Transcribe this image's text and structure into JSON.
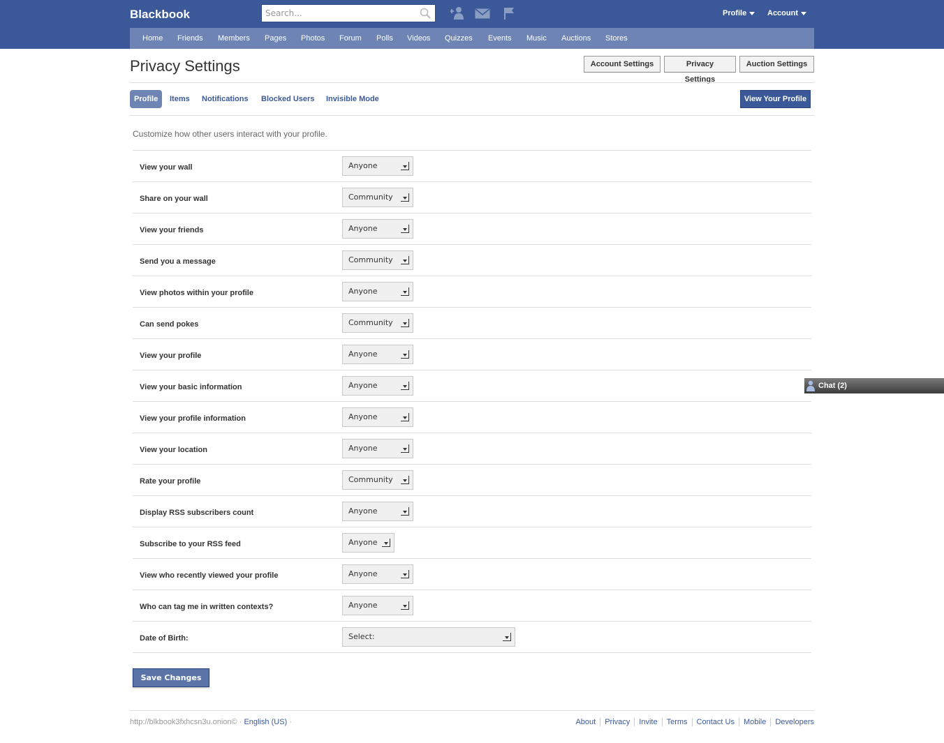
{
  "app": {
    "brand": "Blackbook",
    "search_placeholder": "Search...",
    "top_links": {
      "profile": "Profile",
      "account": "Account"
    }
  },
  "nav": [
    "Home",
    "Friends",
    "Members",
    "Pages",
    "Photos",
    "Forum",
    "Polls",
    "Videos",
    "Quizzes",
    "Events",
    "Music",
    "Auctions",
    "Stores"
  ],
  "page": {
    "title": "Privacy Settings",
    "header_buttons": [
      "Account Settings",
      "Privacy Settings",
      "Auction Settings"
    ],
    "tabs": [
      "Profile",
      "Items",
      "Notifications",
      "Blocked Users",
      "Invisible Mode"
    ],
    "active_tab": "Profile",
    "view_profile_label": "View Your Profile",
    "intro": "Customize how other users interact with your profile."
  },
  "settings": [
    {
      "label": "View your wall",
      "value": "Anyone"
    },
    {
      "label": "Share on your wall",
      "value": "Community"
    },
    {
      "label": "View your friends",
      "value": "Anyone"
    },
    {
      "label": "Send you a message",
      "value": "Community"
    },
    {
      "label": "View photos within your profile",
      "value": "Anyone"
    },
    {
      "label": "Can send pokes",
      "value": "Community"
    },
    {
      "label": "View your profile",
      "value": "Anyone"
    },
    {
      "label": "View your basic information",
      "value": "Anyone"
    },
    {
      "label": "View your profile information",
      "value": "Anyone"
    },
    {
      "label": "View your location",
      "value": "Anyone"
    },
    {
      "label": "Rate your profile",
      "value": "Community"
    },
    {
      "label": "Display RSS subscribers count",
      "value": "Anyone"
    },
    {
      "label": "Subscribe to your RSS feed",
      "value": "Anyone"
    },
    {
      "label": "View who recently viewed your profile",
      "value": "Anyone"
    },
    {
      "label": "Who can tag me in written contexts?",
      "value": "Anyone"
    },
    {
      "label": "Date of Birth:",
      "value": "Select:"
    }
  ],
  "save_label": "Save Changes",
  "chat_label": "Chat (2)",
  "footer": {
    "site": "http://blkbook3fxhcsn3u.onion©",
    "separator": "·",
    "language": "English (US)",
    "links": [
      "About",
      "Privacy",
      "Invite",
      "Terms",
      "Contact Us",
      "Mobile",
      "Developers"
    ]
  },
  "icons": [
    "search-icon",
    "friend-requests-icon",
    "messages-icon",
    "notifications-flag-icon",
    "chat-user-icon"
  ],
  "colors": {
    "brand": "#3b5998",
    "nav": "#6d84b4",
    "save": "#5b74a8",
    "link": "#3b5998"
  }
}
